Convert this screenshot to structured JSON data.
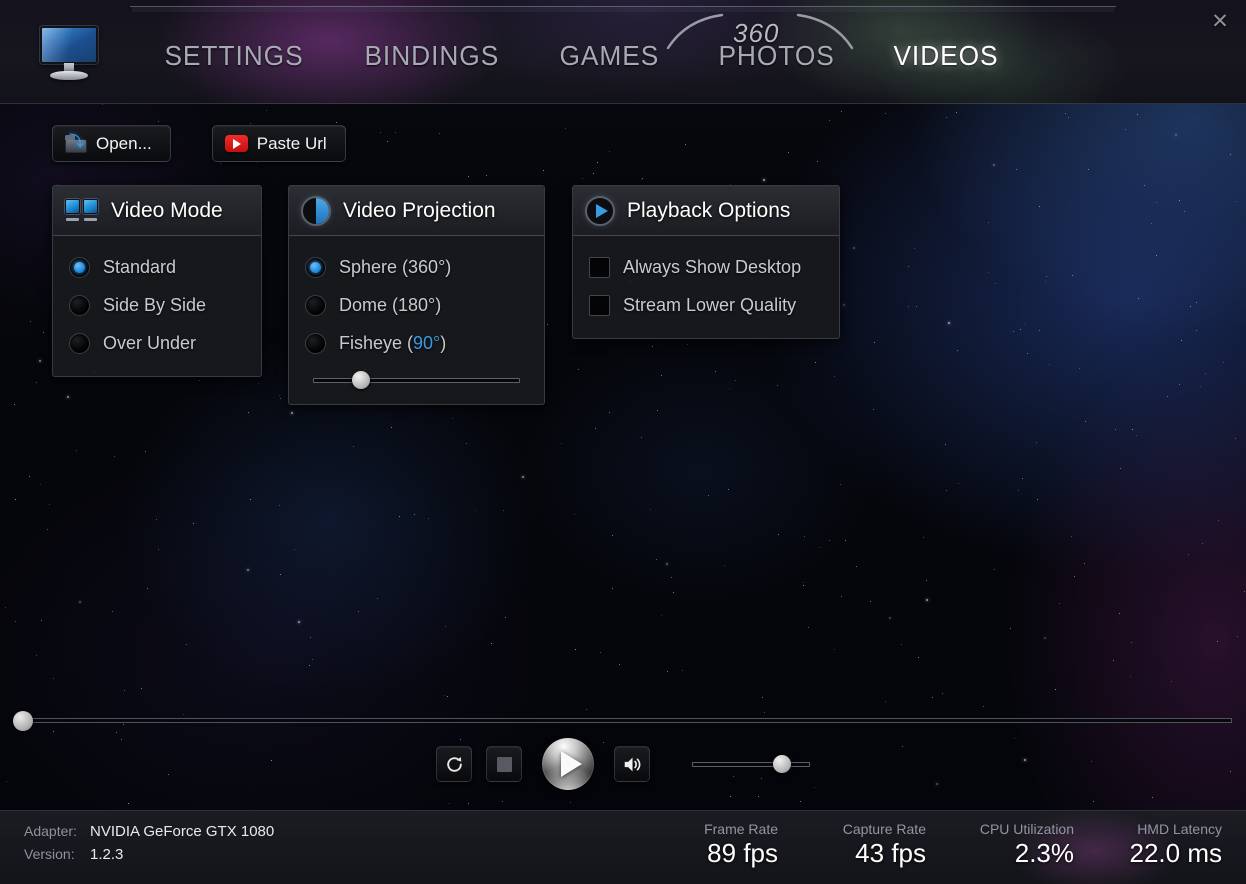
{
  "window": {
    "close_label": "✕"
  },
  "header": {
    "logo_icon": "monitor-icon",
    "badge": "360",
    "tabs": [
      {
        "label": "SETTINGS",
        "active": false
      },
      {
        "label": "BINDINGS",
        "active": false
      },
      {
        "label": "GAMES",
        "active": false
      },
      {
        "label": "PHOTOS",
        "active": false
      },
      {
        "label": "VIDEOS",
        "active": true
      }
    ]
  },
  "toolbar": {
    "open_label": "Open...",
    "open_icon": "folder-open-icon",
    "paste_label": "Paste Url",
    "paste_icon": "youtube-play-icon"
  },
  "panels": {
    "video_mode": {
      "title": "Video Mode",
      "icon": "dual-screen-icon",
      "options": [
        {
          "label": "Standard",
          "selected": true
        },
        {
          "label": "Side By Side",
          "selected": false
        },
        {
          "label": "Over Under",
          "selected": false
        }
      ]
    },
    "video_projection": {
      "title": "Video Projection",
      "icon": "sphere-projection-icon",
      "options": [
        {
          "label": "Sphere (360°)",
          "selected": true,
          "highlight": ""
        },
        {
          "label": "Dome (180°)",
          "selected": false,
          "highlight": ""
        },
        {
          "label": "Fisheye (",
          "selected": false,
          "highlight": "90°",
          "suffix": ")"
        }
      ],
      "fov_slider_percent": 23
    },
    "playback_options": {
      "title": "Playback Options",
      "icon": "play-circle-icon",
      "options": [
        {
          "label": "Always Show Desktop",
          "checked": false
        },
        {
          "label": "Stream Lower Quality",
          "checked": false
        }
      ]
    }
  },
  "player": {
    "seek_percent": 0.7,
    "loop_icon": "loop-icon",
    "stop_icon": "stop-icon",
    "play_icon": "play-icon",
    "volume_icon": "speaker-icon",
    "volume_percent": 76
  },
  "status": {
    "adapter_key": "Adapter:",
    "adapter_value": "NVIDIA GeForce GTX 1080",
    "version_key": "Version:",
    "version_value": "1.2.3",
    "metrics": [
      {
        "key": "Frame Rate",
        "value": "89 fps"
      },
      {
        "key": "Capture Rate",
        "value": "43 fps"
      },
      {
        "key": "CPU Utilization",
        "value": "2.3%"
      },
      {
        "key": "HMD Latency",
        "value": "22.0 ms"
      }
    ]
  },
  "colors": {
    "accent_blue": "#3a9ce0",
    "panel_bg": "#18191d",
    "header_bg": "#17161f",
    "text_primary": "#ffffff",
    "text_secondary": "#c7cad1",
    "text_muted": "#8e929b",
    "youtube_red": "#ef2d2d"
  }
}
